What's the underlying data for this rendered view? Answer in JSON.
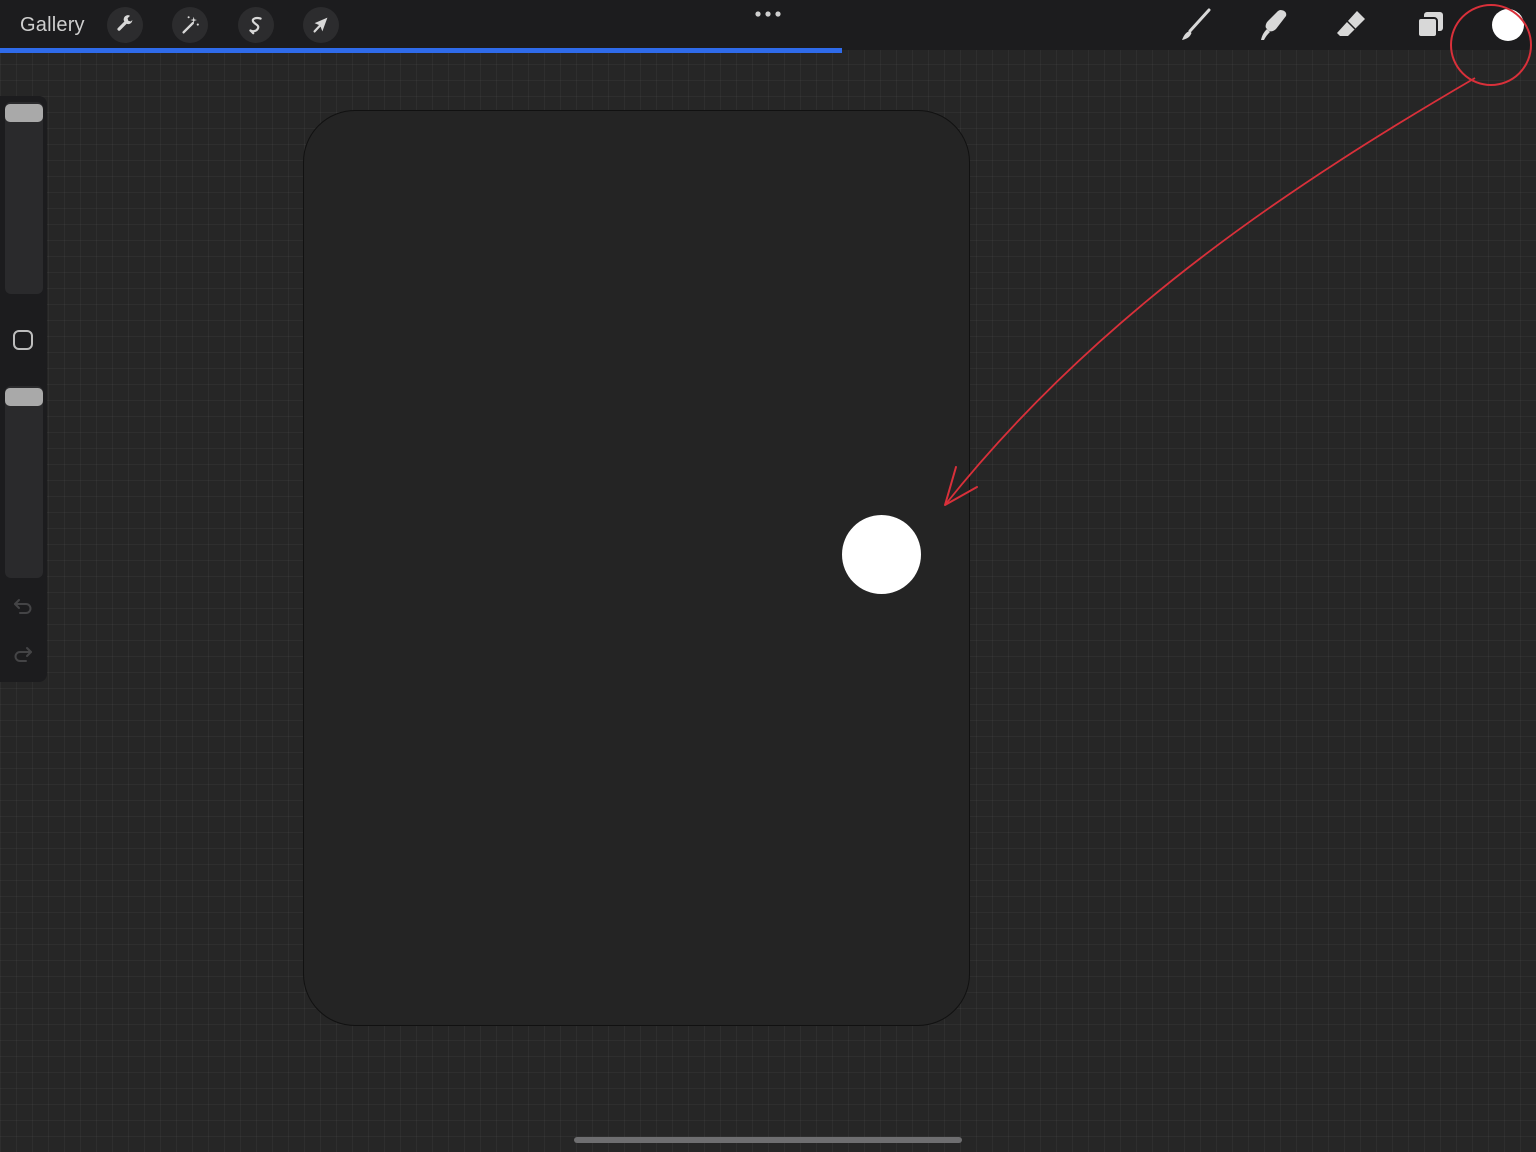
{
  "topbar": {
    "gallery_label": "Gallery",
    "left_tools": [
      {
        "name": "actions",
        "icon": "wrench-icon"
      },
      {
        "name": "adjustments",
        "icon": "magic-wand-icon"
      },
      {
        "name": "selection",
        "icon": "selection-s-icon"
      },
      {
        "name": "transform",
        "icon": "arrow-cursor-icon"
      }
    ],
    "more_icon": "ellipsis-icon",
    "right_tools": [
      {
        "name": "brush",
        "icon": "brush-icon"
      },
      {
        "name": "smudge",
        "icon": "smudge-icon"
      },
      {
        "name": "eraser",
        "icon": "eraser-icon"
      },
      {
        "name": "layers",
        "icon": "layers-icon"
      },
      {
        "name": "colors",
        "icon": "color-swatch"
      }
    ],
    "current_color": "#ffffff",
    "progress_fraction": 0.548,
    "progress_color": "#2f6bea"
  },
  "sidebar": {
    "brush_size_level": 1.0,
    "opacity_level": 1.0,
    "modify_icon": "square-modify-icon",
    "undo_icon": "undo-icon",
    "redo_icon": "redo-icon"
  },
  "canvas": {
    "background": "#242424",
    "dot_color": "#ffffff"
  },
  "annotation": {
    "color": "#d9303a"
  }
}
